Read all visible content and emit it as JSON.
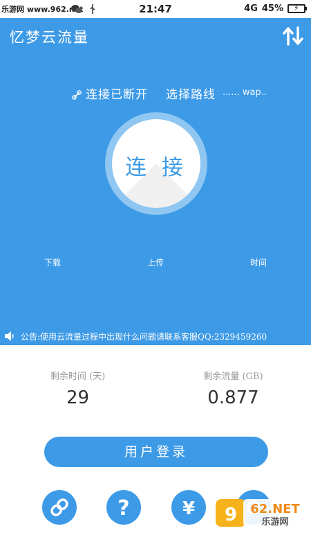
{
  "statusbar": {
    "watermark": "乐游网 www.962.net",
    "time": "21:47",
    "network": "4G",
    "battery": "45%"
  },
  "header": {
    "title": "忆梦云流量"
  },
  "connection": {
    "status": "连接已断开",
    "route_label": "选择路线",
    "route_name": "...... wap.."
  },
  "connect_button": {
    "label": "连 接"
  },
  "stats": {
    "download_label": "下载",
    "upload_label": "上传",
    "time_label": "时间"
  },
  "notice": {
    "text": "公告:使用云流量过程中出现什么问题请联系客服QQ:2329459260"
  },
  "quota": {
    "time_label": "剩余时间 (天)",
    "time_value": "29",
    "traffic_label": "剩余流量 (GB)",
    "traffic_value": "0.877"
  },
  "login_button": {
    "label": "用户登录"
  },
  "bottom_nav": [
    {
      "icon": "link-icon"
    },
    {
      "icon": "question-icon"
    },
    {
      "icon": "yen-icon"
    },
    {
      "icon": "gear-icon"
    }
  ],
  "watermark_br": {
    "brand": "962.NET",
    "sub": "乐游网"
  },
  "colors": {
    "primary": "#3d9ae6",
    "ring": "#8fc7f2",
    "text_dark": "#333333",
    "text_muted": "#999999"
  }
}
